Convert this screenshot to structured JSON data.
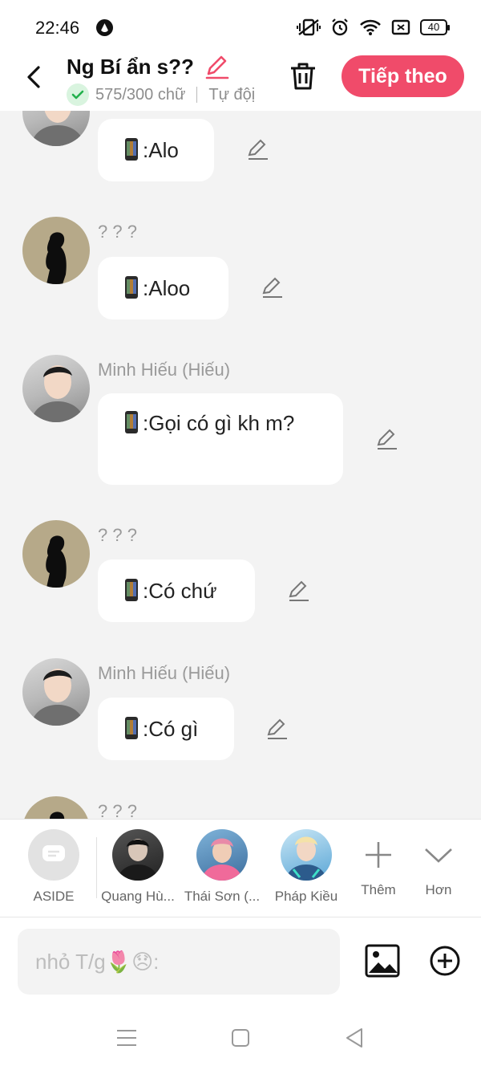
{
  "status_bar": {
    "time": "22:46",
    "battery": "40"
  },
  "header": {
    "title": "Ng Bí ẩn s??",
    "word_count": "575/300 chữ",
    "mode": "Tự độị",
    "next_label": "Tiếp theo"
  },
  "messages": [
    {
      "sender": "",
      "text": ":Alo",
      "avatar": "photo"
    },
    {
      "sender": "? ? ?",
      "text": ":Aloo",
      "avatar": "silhouette"
    },
    {
      "sender": "Minh Hiếu (Hiếu)",
      "text": ":Gọi có gì kh m?",
      "avatar": "photo"
    },
    {
      "sender": "? ? ?",
      "text": ":Có chứ",
      "avatar": "silhouette"
    },
    {
      "sender": "Minh Hiếu (Hiếu)",
      "text": ":Có gì",
      "avatar": "photo"
    },
    {
      "sender": "? ? ?",
      "text": "",
      "avatar": "silhouette"
    }
  ],
  "characters": [
    {
      "label": "ASIDE"
    },
    {
      "label": "Quang Hù..."
    },
    {
      "label": "Thái Sơn (..."
    },
    {
      "label": "Pháp Kiều"
    },
    {
      "label": "Thêm"
    },
    {
      "label": "Hơn"
    }
  ],
  "composer": {
    "placeholder": "nhỏ T/g🌷😞:"
  },
  "colors": {
    "accent": "#f04b6a",
    "check_green": "#22b14c"
  }
}
